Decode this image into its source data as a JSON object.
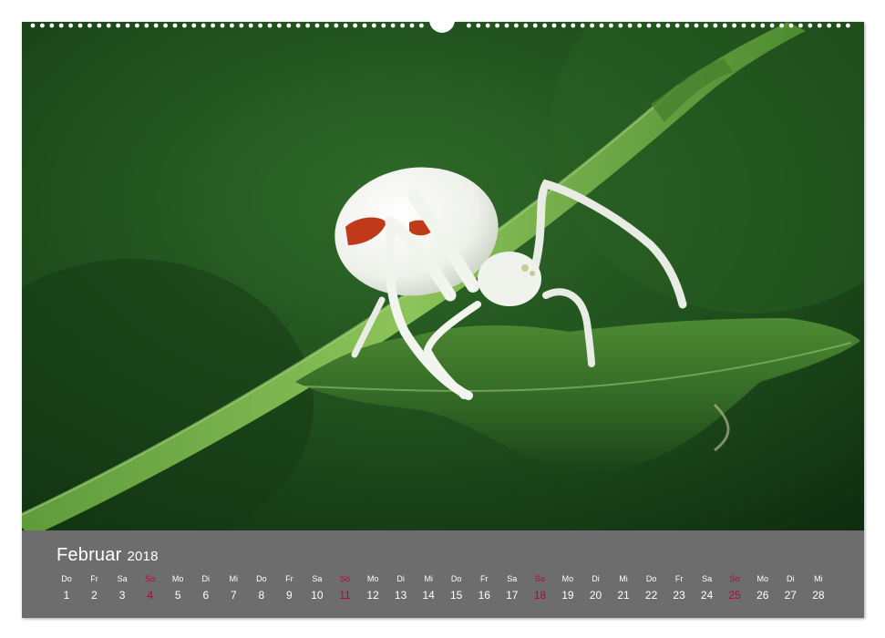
{
  "calendar": {
    "month": "Februar",
    "year": "2018",
    "accent_color": "#c0002f",
    "days": [
      {
        "dn": "Do",
        "dd": "1",
        "sunday": false
      },
      {
        "dn": "Fr",
        "dd": "2",
        "sunday": false
      },
      {
        "dn": "Sa",
        "dd": "3",
        "sunday": false
      },
      {
        "dn": "So",
        "dd": "4",
        "sunday": true
      },
      {
        "dn": "Mo",
        "dd": "5",
        "sunday": false
      },
      {
        "dn": "Di",
        "dd": "6",
        "sunday": false
      },
      {
        "dn": "Mi",
        "dd": "7",
        "sunday": false
      },
      {
        "dn": "Do",
        "dd": "8",
        "sunday": false
      },
      {
        "dn": "Fr",
        "dd": "9",
        "sunday": false
      },
      {
        "dn": "Sa",
        "dd": "10",
        "sunday": false
      },
      {
        "dn": "So",
        "dd": "11",
        "sunday": true
      },
      {
        "dn": "Mo",
        "dd": "12",
        "sunday": false
      },
      {
        "dn": "Di",
        "dd": "13",
        "sunday": false
      },
      {
        "dn": "Mi",
        "dd": "14",
        "sunday": false
      },
      {
        "dn": "Do",
        "dd": "15",
        "sunday": false
      },
      {
        "dn": "Fr",
        "dd": "16",
        "sunday": false
      },
      {
        "dn": "Sa",
        "dd": "17",
        "sunday": false
      },
      {
        "dn": "So",
        "dd": "18",
        "sunday": true
      },
      {
        "dn": "Mo",
        "dd": "19",
        "sunday": false
      },
      {
        "dn": "Di",
        "dd": "20",
        "sunday": false
      },
      {
        "dn": "Mi",
        "dd": "21",
        "sunday": false
      },
      {
        "dn": "Do",
        "dd": "22",
        "sunday": false
      },
      {
        "dn": "Fr",
        "dd": "23",
        "sunday": false
      },
      {
        "dn": "Sa",
        "dd": "24",
        "sunday": false
      },
      {
        "dn": "So",
        "dd": "25",
        "sunday": true
      },
      {
        "dn": "Mo",
        "dd": "26",
        "sunday": false
      },
      {
        "dn": "Di",
        "dd": "27",
        "sunday": false
      },
      {
        "dn": "Mi",
        "dd": "28",
        "sunday": false
      }
    ]
  },
  "photo": {
    "subject": "spider-on-leaf-icon",
    "background_color": "#1f4a1c"
  }
}
